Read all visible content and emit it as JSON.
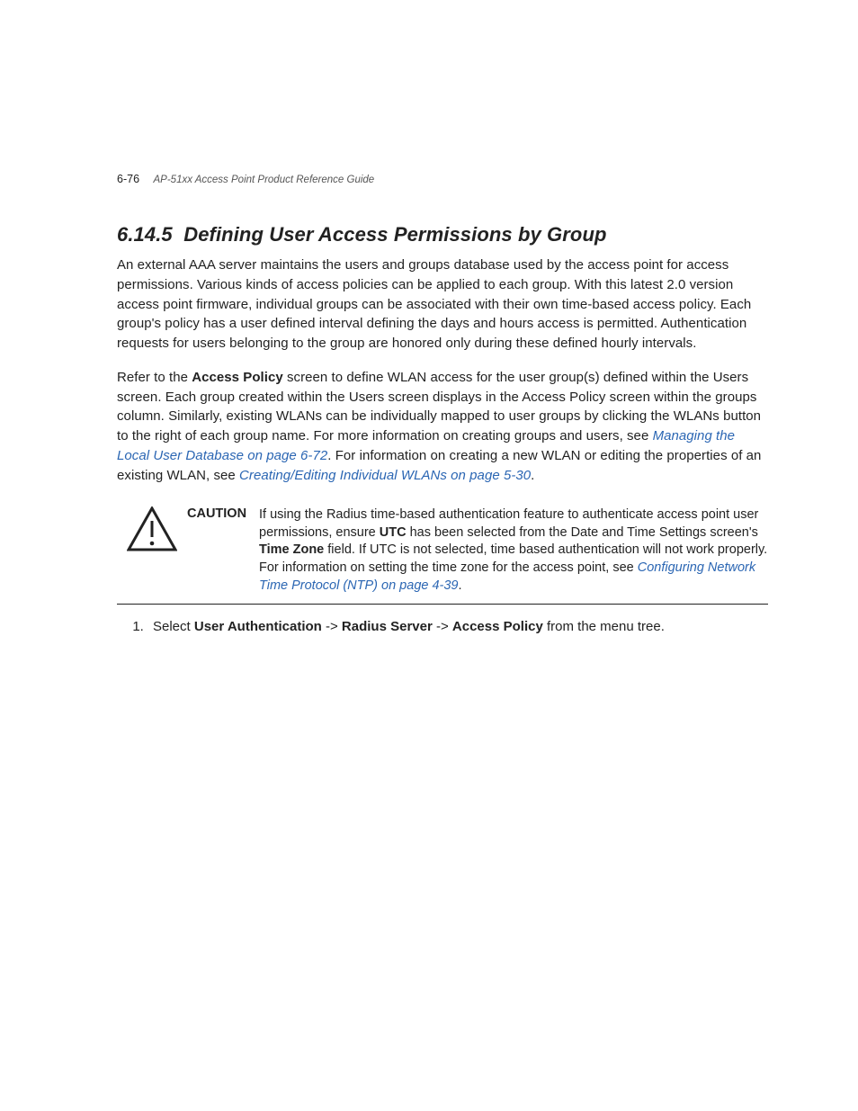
{
  "header": {
    "page_num": "6-76",
    "guide_name": "AP-51xx Access Point Product Reference Guide"
  },
  "section": {
    "number": "6.14.5",
    "title": "Defining User Access Permissions by Group"
  },
  "para1": "An external AAA server maintains the users and groups database used by the access point for access permissions. Various kinds of access policies can be applied to each group. With this latest 2.0 version access point firmware, individual groups can be associated with their own time-based access policy. Each group's policy has a user defined interval defining the days and hours access is permitted. Authentication requests for users belonging to the group are honored only during these defined hourly intervals.",
  "para2": {
    "pre": "Refer to the ",
    "ui1": "Access Policy",
    "mid1": " screen to define WLAN access for the user group(s) defined within the Users screen. Each group created within the Users screen displays in the Access Policy screen within the groups column. Similarly, existing WLANs can be individually mapped to user groups by clicking the WLANs button to the right of each group name. For more information on creating groups and users, see ",
    "link1": "Managing the Local User Database on page 6-72",
    "mid2": ". For information on creating a new WLAN or editing the properties of an existing WLAN, see ",
    "link2": "Creating/Editing Individual WLANs on page 5-30",
    "post": "."
  },
  "caution": {
    "label": "CAUTION",
    "pre": "If using the Radius time-based authentication feature to authenticate access point user permissions, ensure ",
    "ui1": "UTC",
    "mid1": " has been selected from the Date and Time Settings screen's ",
    "ui2": "Time Zone",
    "mid2": " field. If UTC is not selected, time based authentication will not work properly. For information on setting the time zone for the access point, see ",
    "link": "Configuring Network Time Protocol (NTP) on page 4-39",
    "post": "."
  },
  "step1": {
    "pre": "Select ",
    "ui1": "User Authentication",
    "sep1": " -> ",
    "ui2": "Radius Server",
    "sep2": " -> ",
    "ui3": "Access Policy",
    "post": " from the menu tree."
  },
  "icons": {
    "caution": "caution-triangle-icon"
  }
}
